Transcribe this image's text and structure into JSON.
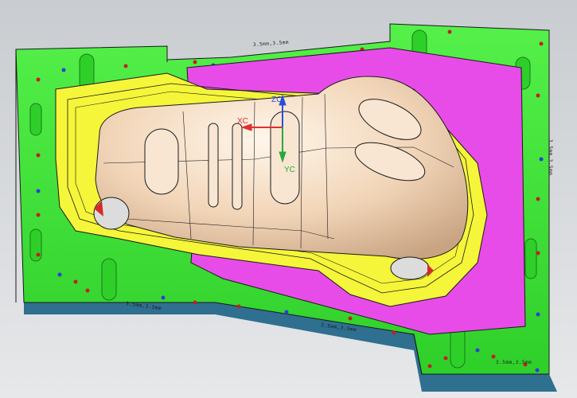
{
  "scene": {
    "background_top": "#c9ccd0",
    "background_bottom": "#e6e8ea",
    "colors": {
      "plate_green": "#3ee63a",
      "plate_green_dark": "#22a81f",
      "plate_edge_blue": "#2f6f8f",
      "insert_yellow": "#f5f53a",
      "insert_magenta": "#e84ce8",
      "part_surface": "#f4dcc4",
      "part_shadow": "#d8b89c",
      "outline": "#1a1a1a"
    }
  },
  "wcs": {
    "zc_label": "ZC",
    "xc_label": "XC",
    "yc_label": "YC",
    "zc_color": "#2a4fd8",
    "xc_color": "#e03030",
    "yc_color": "#2aa83a"
  },
  "plate_markings": [
    "3.5mm,3.5mm",
    "3.5mm,3.5mm",
    "3.5mm,3.5mm",
    "3.5mm,3.5mm",
    "3.5mm,3.5mm",
    "3.5mm,3.5mm",
    "3.5mm,3.5mm"
  ]
}
